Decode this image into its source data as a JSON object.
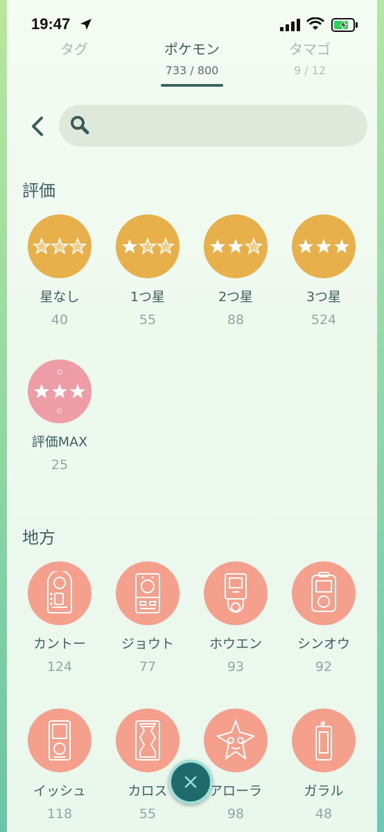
{
  "status": {
    "time": "19:47"
  },
  "tabs": [
    {
      "label": "タグ",
      "count": ""
    },
    {
      "label": "ポケモン",
      "count": "733 / 800"
    },
    {
      "label": "タマゴ",
      "count": "9 / 12"
    }
  ],
  "search": {
    "value": "",
    "placeholder": ""
  },
  "rating": {
    "title": "評価",
    "items": [
      {
        "name": "星なし",
        "count": "40"
      },
      {
        "name": "1つ星",
        "count": "55"
      },
      {
        "name": "2つ星",
        "count": "88"
      },
      {
        "name": "3つ星",
        "count": "524"
      },
      {
        "name": "評価MAX",
        "count": "25"
      }
    ]
  },
  "region": {
    "title": "地方",
    "items": [
      {
        "name": "カントー",
        "count": "124"
      },
      {
        "name": "ジョウト",
        "count": "77"
      },
      {
        "name": "ホウエン",
        "count": "93"
      },
      {
        "name": "シンオウ",
        "count": "92"
      },
      {
        "name": "イッシュ",
        "count": "118"
      },
      {
        "name": "カロス",
        "count": "55"
      },
      {
        "name": "アローラ",
        "count": "98"
      },
      {
        "name": "ガラル",
        "count": "48"
      }
    ]
  },
  "colors": {
    "rating_gold": "#e7b04b",
    "rating_max_pink": "#ee9ca6",
    "region_salmon": "#f4a08d",
    "accent_teal": "#3e6464"
  }
}
